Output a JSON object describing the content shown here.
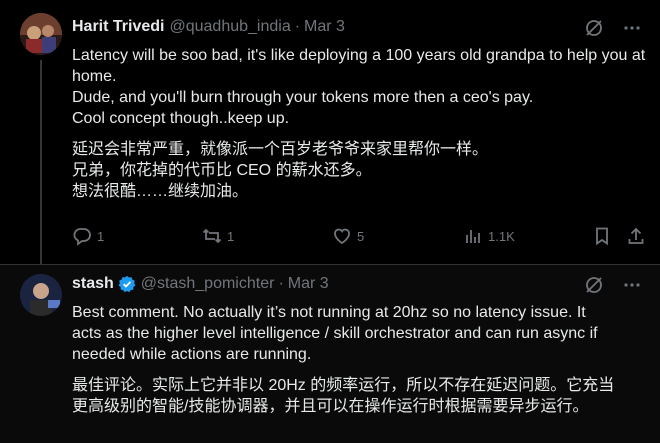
{
  "tweets": [
    {
      "author": {
        "name": "Harit Trivedi",
        "handle": "@quadhub_india",
        "date": "Mar 3"
      },
      "text_en": [
        "Latency will be soo bad, it's like deploying a 100 years old grandpa to help you at home.",
        "Dude, and you'll burn through your tokens more then a ceo's pay.",
        "Cool concept though..keep up."
      ],
      "text_zh": [
        "延迟会非常严重，就像派一个百岁老爷爷来家里帮你一样。",
        "兄弟，你花掉的代币比 CEO 的薪水还多。",
        "想法很酷……继续加油。"
      ],
      "stats": {
        "replies": "1",
        "reposts": "1",
        "likes": "5",
        "views": "1.1K"
      }
    },
    {
      "author": {
        "name": "stash",
        "handle": "@stash_pomichter",
        "date": "Mar 3"
      },
      "text_en": [
        "Best comment. No actually it’s not running at 20hz so no latency issue. It",
        "acts as the higher level intelligence / skill orchestrator and can run async if",
        "needed while actions are running."
      ],
      "text_zh": [
        "最佳评论。实际上它并非以 20Hz 的频率运行，所以不存在延迟问题。它充当",
        "更高级别的智能/技能协调器，并且可以在操作运行时根据需要异步运行。"
      ]
    }
  ],
  "colors": {
    "background": "#000000",
    "text": "#e7e9ea",
    "muted": "#71767b",
    "verified": "#1d9bf0"
  },
  "icons": [
    "grok-icon",
    "more-icon",
    "reply-icon",
    "repost-icon",
    "like-icon",
    "views-icon",
    "bookmark-icon",
    "share-icon",
    "verified-badge-icon"
  ]
}
